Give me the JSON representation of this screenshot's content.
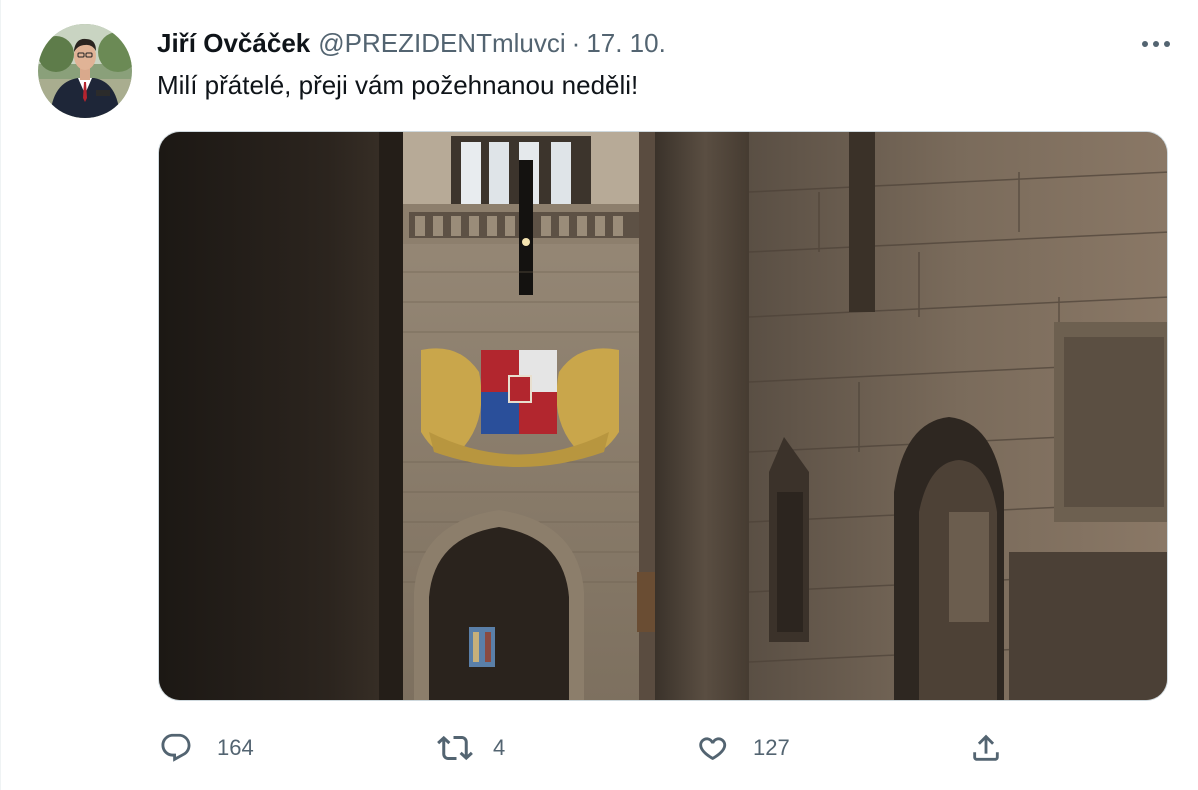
{
  "tweet": {
    "author": {
      "display_name": "Jiří Ovčáček",
      "handle": "@PREZIDENTmluvci",
      "separator": "·",
      "date": "17. 10."
    },
    "text": "Milí přátelé, přeji vám požehnanou neděli!",
    "more_icon": "more-horizontal-icon",
    "actions": {
      "reply": {
        "icon": "reply-icon",
        "count": "164"
      },
      "retweet": {
        "icon": "retweet-icon",
        "count": "4"
      },
      "like": {
        "icon": "heart-icon",
        "count": "127"
      },
      "share": {
        "icon": "share-icon"
      }
    }
  },
  "colors": {
    "text_primary": "#0f1419",
    "text_secondary": "#536471",
    "border": "#cfd9de"
  }
}
